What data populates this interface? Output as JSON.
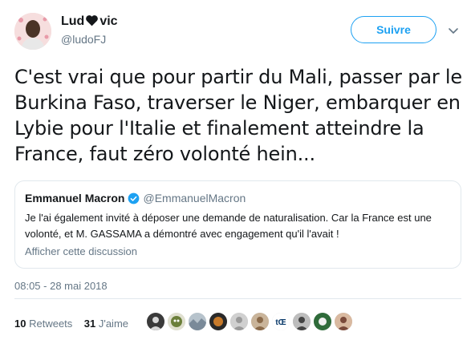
{
  "author": {
    "name_part1": "Lud",
    "name_part2": "vic",
    "name_emoji": "black-heart-icon",
    "handle": "@ludoFJ"
  },
  "follow_button": {
    "label": "Suivre",
    "color": "#1da1f2"
  },
  "tweet": {
    "text": "C'est vrai que pour partir du Mali, passer par le Burkina Faso, traverser le Niger, embarquer en Lybie pour l'Italie et finalement atteindre la France, faut zéro volonté hein...",
    "timestamp": "08:05 - 28 mai 2018"
  },
  "quoted_tweet": {
    "name": "Emmanuel Macron",
    "verified": true,
    "handle": "@EmmanuelMacron",
    "text": "Je l'ai également invité à déposer une demande de naturalisation. Car la France est une volonté, et M. GASSAMA a démontré avec engagement qu'il l'avait !",
    "show_discussion_label": "Afficher cette discussion"
  },
  "stats": {
    "retweets_count": "10",
    "retweets_label": "Retweets",
    "likes_count": "31",
    "likes_label": "J'aime"
  },
  "liker_avatars": [
    {
      "icon": "avatar-icon",
      "color": "#3a3a3a"
    },
    {
      "icon": "avatar-icon",
      "color": "#6b7f3a"
    },
    {
      "icon": "avatar-icon",
      "color": "#7a8a99"
    },
    {
      "icon": "avatar-icon",
      "color": "#c77a2a"
    },
    {
      "icon": "avatar-icon",
      "color": "#9a9a9a"
    },
    {
      "icon": "avatar-icon",
      "color": "#8a6a4a"
    },
    {
      "icon": "avatar-icon",
      "color": "#ffffff",
      "text": "tŒ"
    },
    {
      "icon": "avatar-icon",
      "color": "#444444"
    },
    {
      "icon": "avatar-icon",
      "color": "#2f6b3a"
    },
    {
      "icon": "avatar-icon",
      "color": "#7a4a3a"
    }
  ]
}
